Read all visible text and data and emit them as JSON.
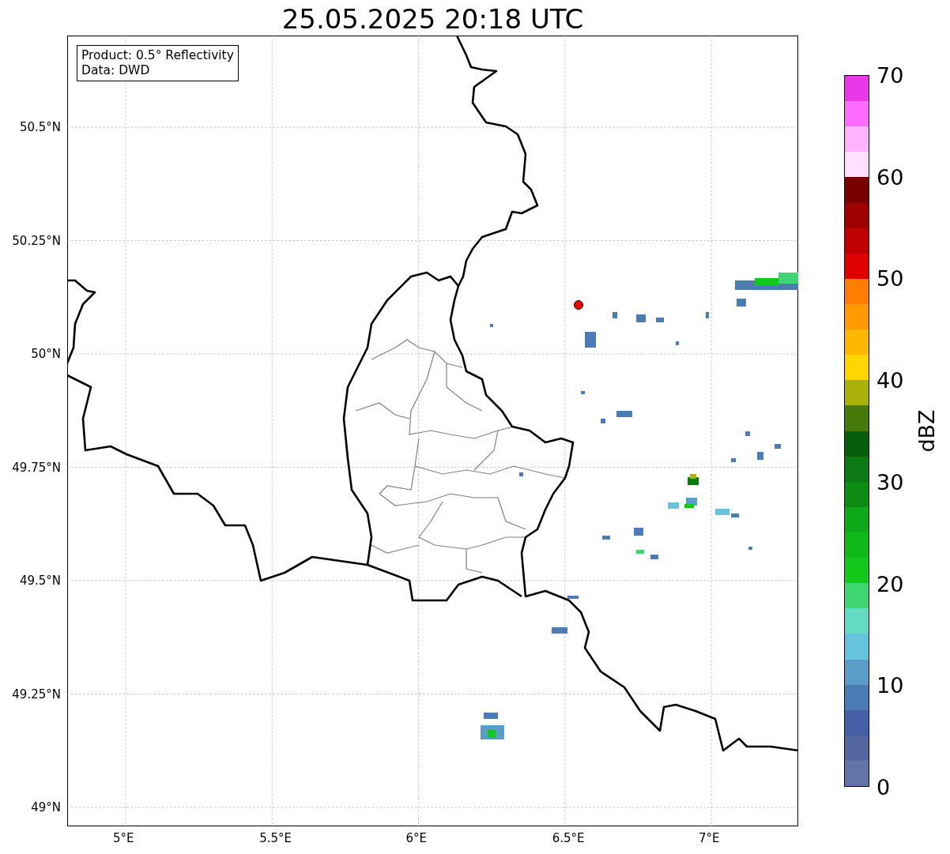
{
  "title": "25.05.2025 20:18 UTC",
  "legend": [
    "Product: 0.5° Reflectivity",
    "Data: DWD"
  ],
  "map": {
    "xticks": [
      "5°E",
      "5.5°E",
      "6°E",
      "6.5°E",
      "7°E"
    ],
    "yticks": [
      "50.5°N",
      "50.25°N",
      "50°N",
      "49.75°N",
      "49.5°N",
      "49.25°N",
      "49°N"
    ]
  },
  "colorbar": {
    "label": "dBZ",
    "ticks": [
      "70",
      "60",
      "50",
      "40",
      "30",
      "20",
      "10",
      "0"
    ],
    "bins": [
      {
        "color": "#e838e8"
      },
      {
        "color": "#ff6bff"
      },
      {
        "color": "#ffb3ff"
      },
      {
        "color": "#ffe0ff"
      },
      {
        "color": "#780000"
      },
      {
        "color": "#a00000"
      },
      {
        "color": "#c00000"
      },
      {
        "color": "#e00000"
      },
      {
        "color": "#ff7d00"
      },
      {
        "color": "#ff9a00"
      },
      {
        "color": "#ffb800"
      },
      {
        "color": "#ffd600"
      },
      {
        "color": "#aab20a"
      },
      {
        "color": "#457a0a"
      },
      {
        "color": "#065e0a"
      },
      {
        "color": "#0b7a12"
      },
      {
        "color": "#0c8c14"
      },
      {
        "color": "#0fa818"
      },
      {
        "color": "#10b91a"
      },
      {
        "color": "#12c91a"
      },
      {
        "color": "#3dd672"
      },
      {
        "color": "#64d9c4"
      },
      {
        "color": "#66c3dc"
      },
      {
        "color": "#5a9dc8"
      },
      {
        "color": "#4c7cb4"
      },
      {
        "color": "#435fa6"
      },
      {
        "color": "#5466a0"
      },
      {
        "color": "#6474a8"
      }
    ]
  }
}
